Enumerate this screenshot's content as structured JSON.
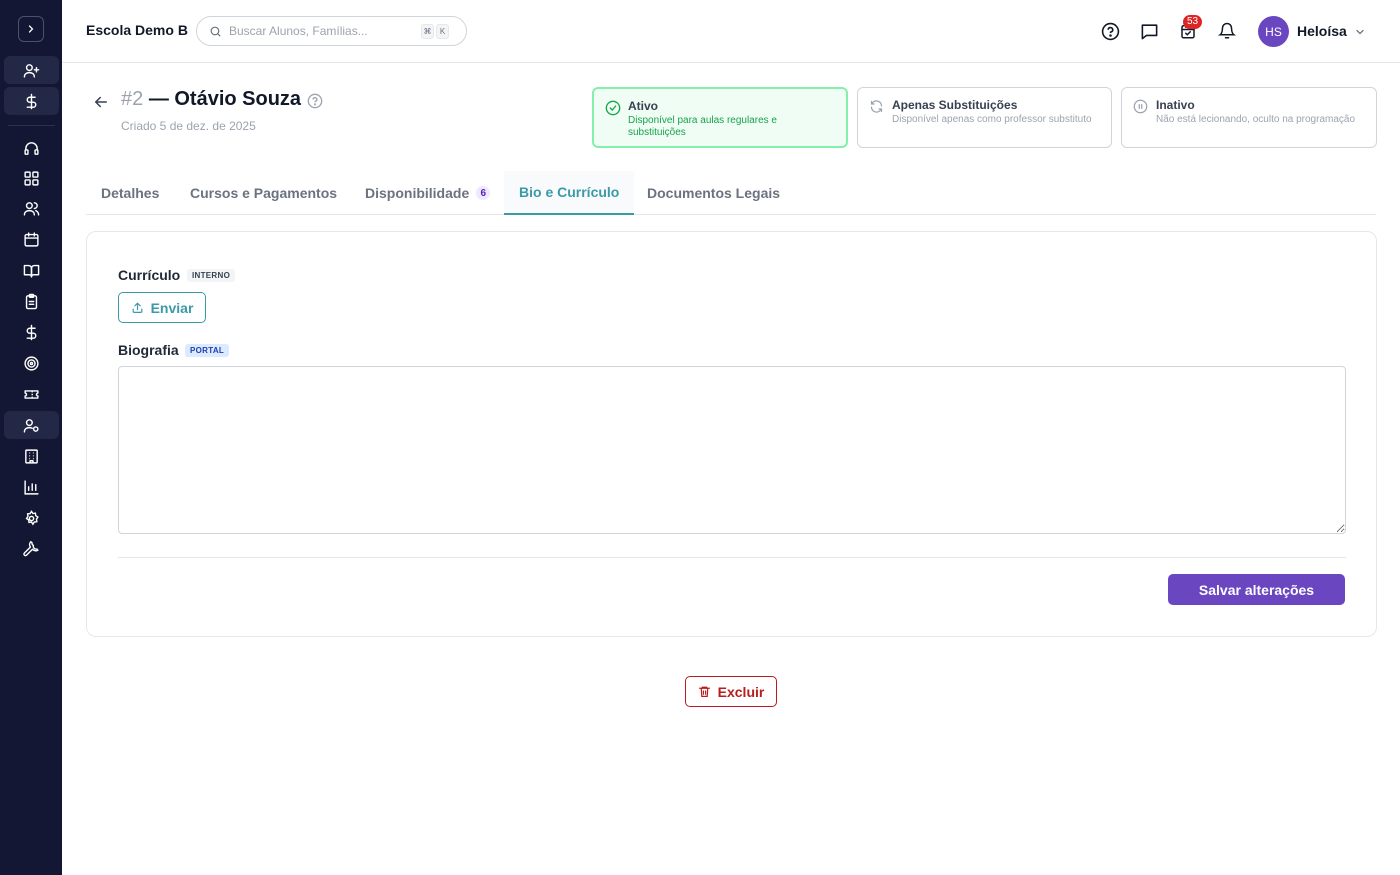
{
  "topbar": {
    "school_name": "Escola Demo B",
    "search_placeholder": "Buscar Alunos, Famílias...",
    "kbd_mod": "⌘",
    "kbd_key": "K",
    "tasks_badge": "53",
    "avatar_initials": "HS",
    "user_name": "Heloísa"
  },
  "sidebar": {
    "icons": [
      "user-plus-icon",
      "dollar-icon",
      "headset-icon",
      "dashboard-icon",
      "users-icon",
      "calendar-icon",
      "book-icon",
      "clipboard-icon",
      "dollar-icon",
      "target-icon",
      "ticket-icon",
      "user-cog-icon",
      "building-icon",
      "chart-icon",
      "settings-icon",
      "wrench-icon"
    ]
  },
  "header": {
    "id_label": "#2",
    "name": "— Otávio Souza",
    "created": "Criado 5 de dez. de 2025"
  },
  "status_options": [
    {
      "title": "Ativo",
      "desc": "Disponível para aulas regulares e substituições",
      "selected": true
    },
    {
      "title": "Apenas Substituições",
      "desc": "Disponível apenas como professor substituto",
      "selected": false
    },
    {
      "title": "Inativo",
      "desc": "Não está lecionando, oculto na programação",
      "selected": false
    }
  ],
  "tabs": [
    {
      "label": "Detalhes"
    },
    {
      "label": "Cursos e Pagamentos"
    },
    {
      "label": "Disponibilidade",
      "count": "6"
    },
    {
      "label": "Bio e Currículo",
      "active": true
    },
    {
      "label": "Documentos Legais"
    }
  ],
  "form": {
    "resume_label": "Currículo",
    "resume_tag": "INTERNO",
    "upload_label": "Enviar",
    "bio_label": "Biografia",
    "bio_tag": "PORTAL",
    "bio_value": "",
    "save_label": "Salvar alterações"
  },
  "delete_label": "Excluir",
  "colors": {
    "sidebar_bg": "#131733",
    "accent_teal": "#3a9aa8",
    "primary_purple": "#6b46c1",
    "danger": "#b91c1c",
    "success": "#16a34a"
  }
}
